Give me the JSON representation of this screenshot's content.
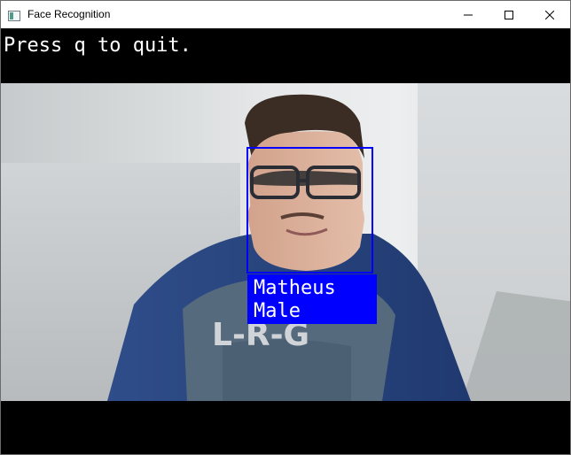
{
  "window": {
    "title": "Face Recognition",
    "controls": [
      "minimize",
      "maximize",
      "close"
    ]
  },
  "overlay": {
    "hint": "Press q to quit.",
    "detection": {
      "name": "Matheus",
      "gender": "Male",
      "box_color": "#0000ff",
      "text_color": "#ffffff"
    }
  },
  "shirt_print": "L-R-G",
  "colors": {
    "letterbox": "#000000",
    "titlebar": "#ffffff"
  }
}
